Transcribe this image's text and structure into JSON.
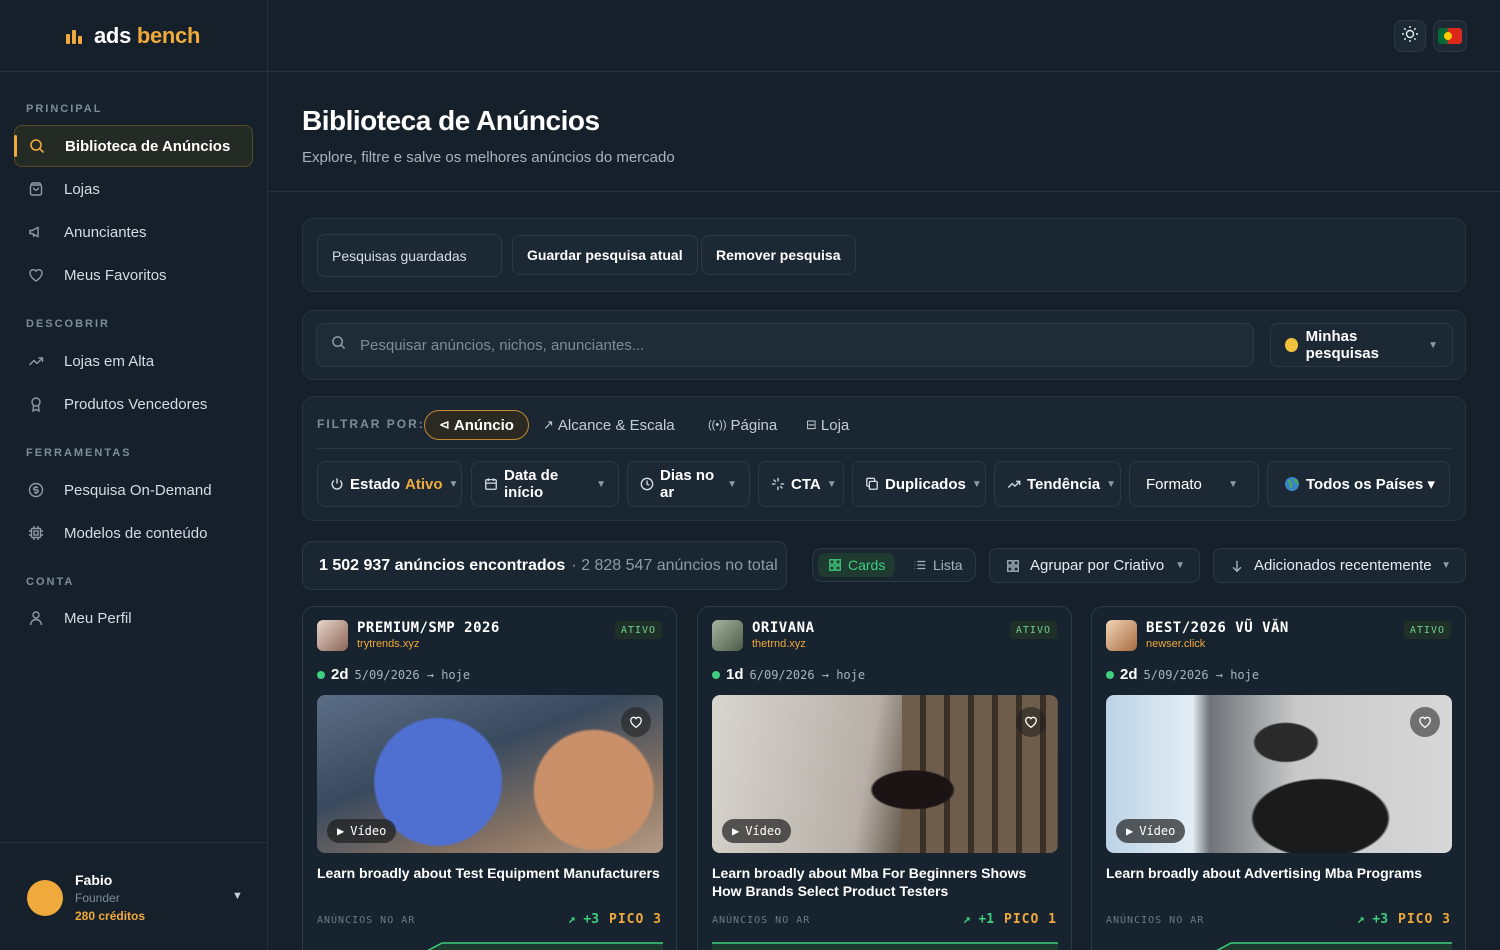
{
  "brand": {
    "name": "ads",
    "accent": "bench"
  },
  "sidebar": {
    "sections": [
      {
        "title": "PRINCIPAL",
        "items": [
          {
            "label": "Biblioteca de Anúncios",
            "icon": "search-icon",
            "active": true
          },
          {
            "label": "Lojas",
            "icon": "bag-icon"
          },
          {
            "label": "Anunciantes",
            "icon": "megaphone-icon"
          },
          {
            "label": "Meus Favoritos",
            "icon": "heart-icon"
          }
        ]
      },
      {
        "title": "DESCOBRIR",
        "items": [
          {
            "label": "Lojas em Alta",
            "icon": "trending-icon"
          },
          {
            "label": "Produtos Vencedores",
            "icon": "award-icon"
          }
        ]
      },
      {
        "title": "FERRAMENTAS",
        "items": [
          {
            "label": "Pesquisa On-Demand",
            "icon": "dollar-icon"
          },
          {
            "label": "Modelos de conteúdo",
            "icon": "chip-icon"
          }
        ]
      },
      {
        "title": "CONTA",
        "items": [
          {
            "label": "Meu Perfil",
            "icon": "user-icon"
          }
        ]
      }
    ],
    "user": {
      "name": "Fabio",
      "role": "Founder",
      "credits": "280 créditos"
    }
  },
  "header": {
    "title": "Biblioteca de Anúncios",
    "subtitle": "Explore, filtre e salve os melhores anúncios do mercado"
  },
  "saved": {
    "saved_searches": "Pesquisas guardadas",
    "save_current": "Guardar pesquisa atual",
    "remove": "Remover pesquisa"
  },
  "search": {
    "placeholder": "Pesquisar anúncios, nichos, anunciantes...",
    "my_searches": "Minhas pesquisas"
  },
  "filters": {
    "label": "FILTRAR POR:",
    "tabs": [
      "Anúncio",
      "Alcance & Escala",
      "Página",
      "Loja"
    ],
    "status_label": "Estado",
    "status_value": "Ativo",
    "start_date": "Data de início",
    "days_live": "Dias no ar",
    "cta": "CTA",
    "duplicates": "Duplicados",
    "trend": "Tendência",
    "format": "Formato",
    "countries": "Todos os Países ▾"
  },
  "results": {
    "found": "1 502 937 anúncios encontrados",
    "total": "· 2 828 547 anúncios no total",
    "view_cards": "Cards",
    "view_list": "Lista",
    "group_by": "Agrupar por Criativo",
    "sort": "Adicionados recentemente"
  },
  "cards": [
    {
      "advertiser": "PREMIUM/SMP 2026",
      "domain": "trytrends.xyz",
      "status": "ATIVO",
      "days": "2d",
      "range": "5/09/2026 → hoje",
      "media": "Vídeo",
      "title": "Learn broadly about Test Equipment Manufacturers",
      "footer": "ANÚNCIOS NO AR",
      "delta": "+3",
      "peak": "PICO 3"
    },
    {
      "advertiser": "ORIVANA",
      "domain": "thetrnd.xyz",
      "status": "ATIVO",
      "days": "1d",
      "range": "6/09/2026 → hoje",
      "media": "Vídeo",
      "title": "Learn broadly about Mba For Beginners Shows How Brands Select Product Testers",
      "footer": "ANÚNCIOS NO AR",
      "delta": "+1",
      "peak": "PICO 1"
    },
    {
      "advertiser": "BEST/2026 VŨ VĂN",
      "domain": "newser.click",
      "status": "ATIVO",
      "days": "2d",
      "range": "5/09/2026 → hoje",
      "media": "Vídeo",
      "title": "Learn broadly about Advertising Mba Programs",
      "footer": "ANÚNCIOS NO AR",
      "delta": "+3",
      "peak": "PICO 3"
    }
  ],
  "colors": {
    "accent": "#f0a93b",
    "success": "#3fcf7e",
    "background": "#15202a",
    "panel": "#1a2632"
  }
}
